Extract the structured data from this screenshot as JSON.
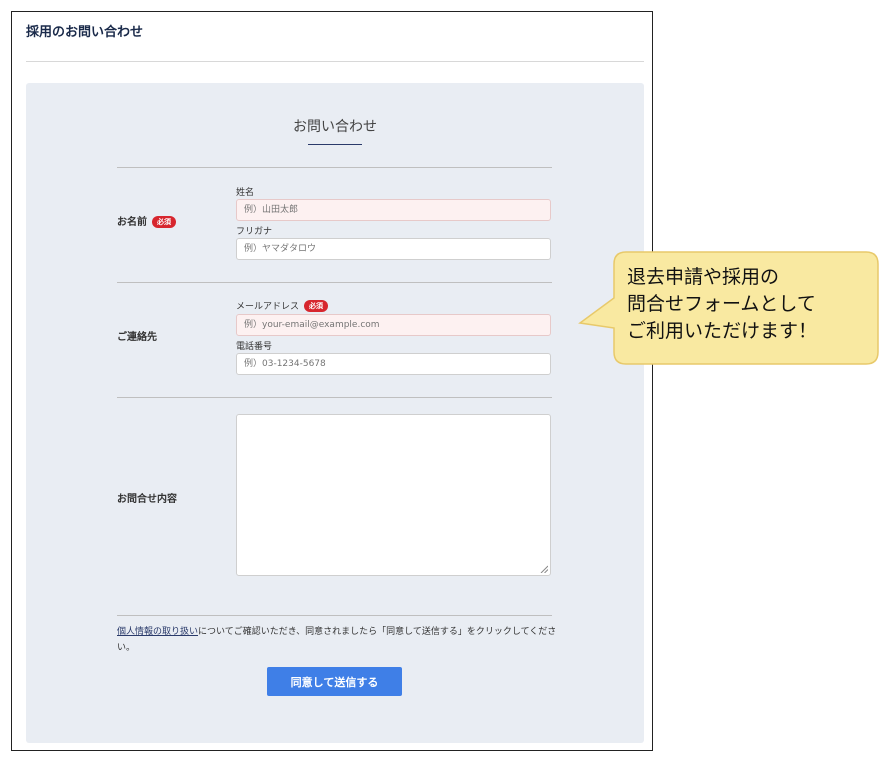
{
  "page": {
    "title": "採用のお問い合わせ"
  },
  "form": {
    "heading": "お問い合わせ",
    "required_badge": "必須",
    "name_row": {
      "label": "お名前",
      "surname_label": "姓名",
      "surname_placeholder": "例）山田太郎",
      "kana_label": "フリガナ",
      "kana_placeholder": "例）ヤマダタロウ"
    },
    "contact_row": {
      "label": "ご連絡先",
      "email_label": "メールアドレス",
      "email_placeholder": "例）your-email@example.com",
      "phone_label": "電話番号",
      "phone_placeholder": "例）03-1234-5678"
    },
    "message_row": {
      "label": "お問合せ内容"
    },
    "privacy": {
      "link_text": "個人情報の取り扱い",
      "text": "についてご確認いただき、同意されましたら「同意して送信する」をクリックしてください。"
    },
    "submit_label": "同意して送信する"
  },
  "callout": {
    "lines": [
      "退去申請や採用の",
      "問合せフォームとして",
      "ご利用いただけます！"
    ],
    "fill": "#f9e9a1",
    "stroke": "#e8c96a"
  },
  "colors": {
    "required_badge": "#d7262e",
    "submit_button": "#3f7fe7",
    "panel_bg": "#e9edf3"
  }
}
